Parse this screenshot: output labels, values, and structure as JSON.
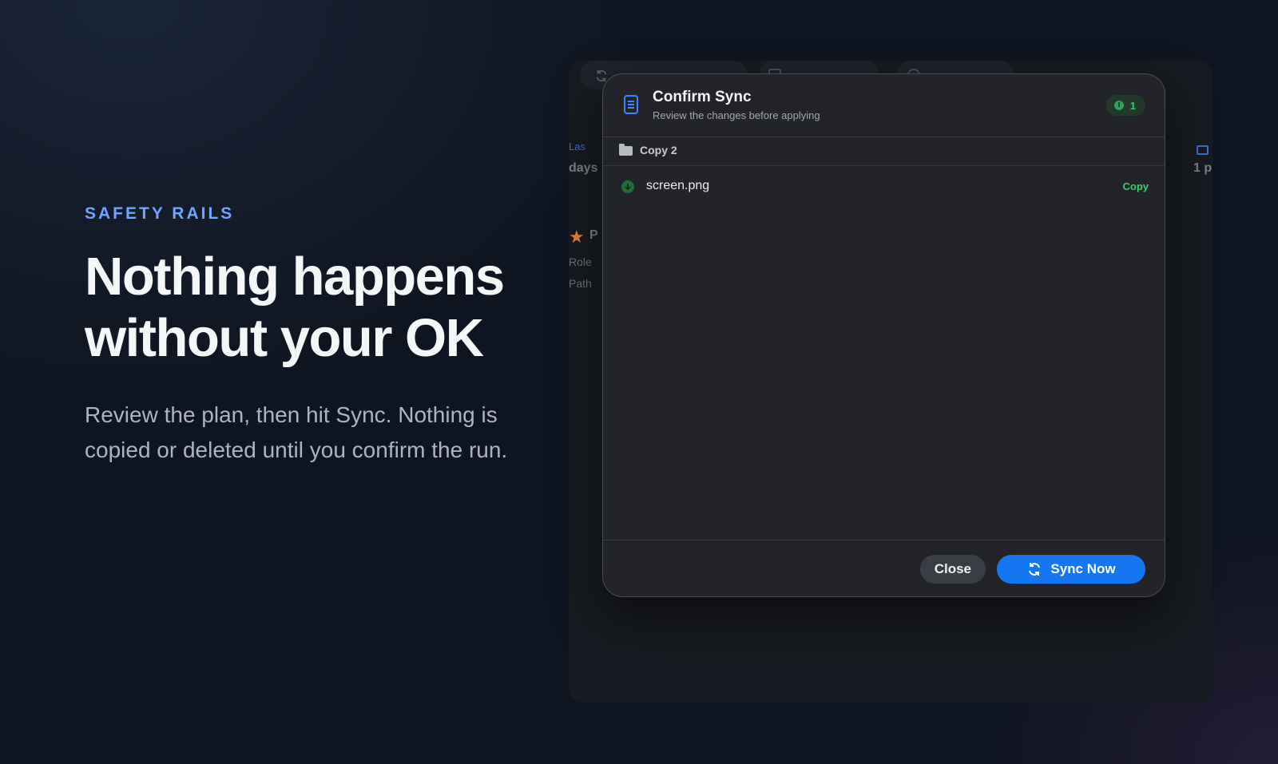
{
  "hero": {
    "eyebrow": "SAFETY RAILS",
    "headline": "Nothing happens without your OK",
    "lede": "Review the plan, then hit Sync. Nothing is copied or deleted until you confirm the run."
  },
  "background_app": {
    "link_text": "Las",
    "days_text": "days",
    "right_text": "1 p",
    "star_label": "P",
    "role_label": "Role",
    "path_label": "Path"
  },
  "modal": {
    "title": "Confirm Sync",
    "subtitle": "Review the changes before applying",
    "badge_count": "1",
    "group": {
      "label": "Copy 2",
      "items": [
        {
          "name": "screen.png",
          "action": "Copy"
        }
      ]
    },
    "close_label": "Close",
    "sync_label": "Sync Now"
  },
  "colors": {
    "accent_blue": "#1577f2",
    "eyebrow_blue": "#6fa4ff",
    "success_green": "#35d06b",
    "modal_bg": "#222429"
  }
}
